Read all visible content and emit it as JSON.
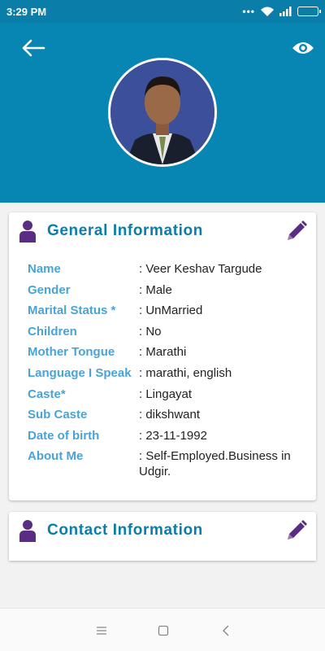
{
  "status_bar": {
    "time": "3:29 PM",
    "icons": [
      "dots-icon",
      "wifi-icon",
      "signal-icon",
      "battery-icon"
    ]
  },
  "header": {
    "icons": {
      "back": "arrow-left-icon",
      "view": "eye-icon"
    },
    "color": "#0785b3"
  },
  "general": {
    "title": "General Information",
    "rows": [
      {
        "label": "Name",
        "value": ": Veer  Keshav Targude"
      },
      {
        "label": "Gender",
        "value": ": Male"
      },
      {
        "label": "Marital Status *",
        "value": ": UnMarried"
      },
      {
        "label": "Children",
        "value": ": No"
      },
      {
        "label": "Mother Tongue",
        "value": ": Marathi"
      },
      {
        "label": "Language I Speak",
        "value": ": marathi, english"
      },
      {
        "label": "Caste*",
        "value": ": Lingayat"
      },
      {
        "label": "Sub Caste",
        "value": ": dikshwant"
      },
      {
        "label": "Date of birth",
        "value": ": 23-11-1992"
      },
      {
        "label": "About Me",
        "value": ": Self-Employed.Business in Udgir."
      }
    ]
  },
  "contact": {
    "title": "Contact Information"
  },
  "colors": {
    "title": "#0a7ea8",
    "label": "#4aa3d6",
    "icon_purple": "#5b2d82"
  }
}
